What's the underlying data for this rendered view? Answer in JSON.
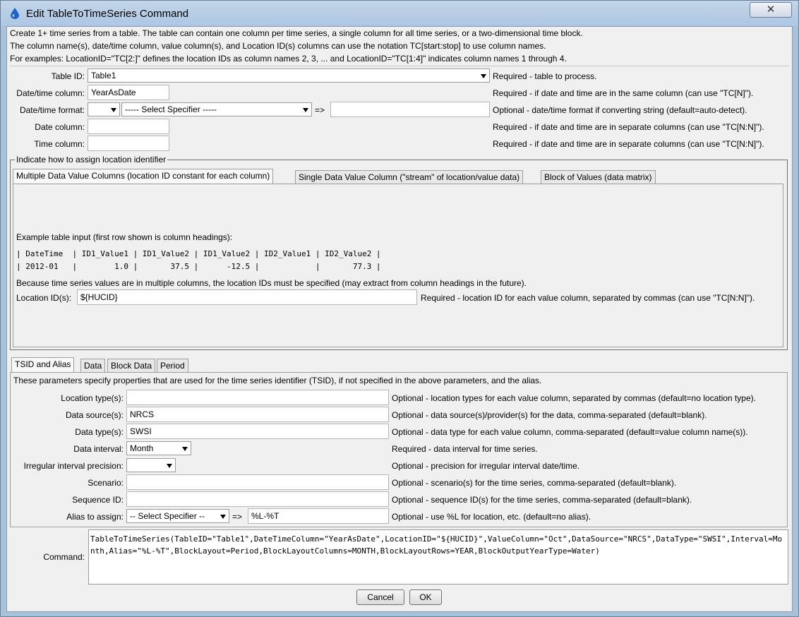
{
  "window": {
    "title": "Edit TableToTimeSeries Command",
    "close_symbol": "✕"
  },
  "description": [
    "Create 1+ time series from a table.  The table can contain one column per time series, a single column for all time series, or a two-dimensional time block.",
    "The column name(s), date/time column, value column(s), and Location ID(s) columns can use the notation TC[start:stop] to use column names.",
    "For examples: LocationID=\"TC[2:]\" defines the location IDs as column names 2, 3, ... and LocationID=\"TC[1:4]\" indicates column names 1 through 4."
  ],
  "table_params": {
    "table_id": {
      "label": "Table ID:",
      "value": "Table1",
      "note": "Required - table to process."
    },
    "datetime_column": {
      "label": "Date/time column:",
      "value": "YearAsDate",
      "note": "Required - if date and time are in the same column (can use \"TC[N]\")."
    },
    "datetime_format": {
      "label": "Date/time format:",
      "type_value": "",
      "specifier_value": "----- Select Specifier -----",
      "arrow": "=>",
      "value": "",
      "note": "Optional - date/time format if converting string (default=auto-detect)."
    },
    "date_column": {
      "label": "Date column:",
      "value": "",
      "note": "Required - if date and time are in separate columns (can use \"TC[N:N]\")."
    },
    "time_column": {
      "label": "Time column:",
      "value": "",
      "note": "Required - if date and time are in separate columns (can use \"TC[N:N]\")."
    }
  },
  "location_group": {
    "title": "Indicate how to assign location identifier",
    "tabs": [
      {
        "label": "Multiple Data Value Columns (location ID constant for each column)"
      },
      {
        "label": "Single Data Value Column (\"stream\" of location/value data)"
      },
      {
        "label": "Block of Values (data matrix)"
      }
    ],
    "example_heading": "Example table input (first row shown is column headings):",
    "example_rows": [
      "| DateTime  | ID1_Value1 | ID1_Value2 | ID1_Value2 | ID2_Value1 | ID2_Value2 |",
      "| 2012-01   |        1.0 |       37.5 |      -12.5 |            |       77.3 |"
    ],
    "explanation": "Because time series values are in multiple columns, the location IDs must be specified (may extract from column headings in the future).",
    "location_ids": {
      "label": "Location ID(s):",
      "value": "${HUCID}",
      "note": "Required - location ID for each value column, separated by commas (can use \"TC[N:N]\")."
    }
  },
  "tsid_section": {
    "tabs": [
      {
        "label": "TSID and Alias"
      },
      {
        "label": "Data"
      },
      {
        "label": "Block Data"
      },
      {
        "label": "Period"
      }
    ],
    "description": "These parameters specify properties that are used for the time series identifier (TSID), if not specified in the above parameters, and the alias.",
    "location_types": {
      "label": "Location type(s):",
      "value": "",
      "note": "Optional - location types for each value column, separated by commas (default=no location type)."
    },
    "data_source": {
      "label": "Data source(s):",
      "value": "NRCS",
      "note": "Optional - data source(s)/provider(s) for the data, comma-separated (default=blank)."
    },
    "data_type": {
      "label": "Data type(s):",
      "value": "SWSI",
      "note": "Optional - data type for each value column, comma-separated (default=value column name(s))."
    },
    "data_interval": {
      "label": "Data interval:",
      "value": "Month",
      "note": "Required - data interval for time series."
    },
    "irregular_precision": {
      "label": "Irregular interval precision:",
      "value": "",
      "note": "Optional - precision for irregular interval date/time."
    },
    "scenario": {
      "label": "Scenario:",
      "value": "",
      "note": "Optional - scenario(s) for the time series, comma-separated (default=blank)."
    },
    "sequence_id": {
      "label": "Sequence ID:",
      "value": "",
      "note": "Optional - sequence ID(s) for the time series, comma-separated (default=blank)."
    },
    "alias": {
      "label": "Alias to assign:",
      "specifier_value": "-- Select Specifier --",
      "arrow": "=>",
      "value": "%L-%T",
      "note": "Optional - use %L for location, etc. (default=no alias)."
    }
  },
  "command": {
    "label": "Command:",
    "value": "TableToTimeSeries(TableID=\"Table1\",DateTimeColumn=\"YearAsDate\",LocationID=\"${HUCID}\",ValueColumn=\"Oct\",DataSource=\"NRCS\",DataType=\"SWSI\",Interval=Month,Alias=\"%L-%T\",BlockLayout=Period,BlockLayoutColumns=MONTH,BlockLayoutRows=YEAR,BlockOutputYearType=Water)"
  },
  "buttons": {
    "cancel": "Cancel",
    "ok": "OK"
  },
  "colors": {
    "titlebar": "#b7cde6",
    "client_bg": "#f0f0f0",
    "icon": "#1e63c8"
  }
}
